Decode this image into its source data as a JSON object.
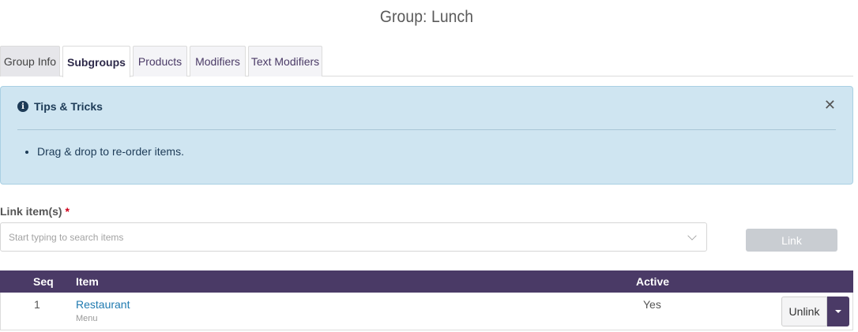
{
  "page": {
    "title": "Group: Lunch"
  },
  "tabs": [
    {
      "label": "Group Info"
    },
    {
      "label": "Subgroups"
    },
    {
      "label": "Products"
    },
    {
      "label": "Modifiers"
    },
    {
      "label": "Text Modifiers"
    }
  ],
  "active_tab": "Subgroups",
  "tips": {
    "title": "Tips & Tricks",
    "items": [
      "Drag & drop to re-order items."
    ],
    "close_icon": "close-icon",
    "info_icon": "info-icon"
  },
  "link_form": {
    "label": "Link item(s)",
    "required_mark": "*",
    "placeholder": "Start typing to search items",
    "value": "",
    "button_label": "Link"
  },
  "table": {
    "headers": {
      "seq": "Seq",
      "item": "Item",
      "active": "Active"
    },
    "rows": [
      {
        "seq": "1",
        "item": "Restaurant",
        "sub": "Menu",
        "active": "Yes",
        "action": "Unlink"
      }
    ]
  },
  "colors": {
    "primary": "#4a3a66",
    "tips_bg": "#cfe5f1",
    "link_color": "#1f7ab0",
    "disabled_btn": "#c9cdd2",
    "required": "#d0021b"
  }
}
